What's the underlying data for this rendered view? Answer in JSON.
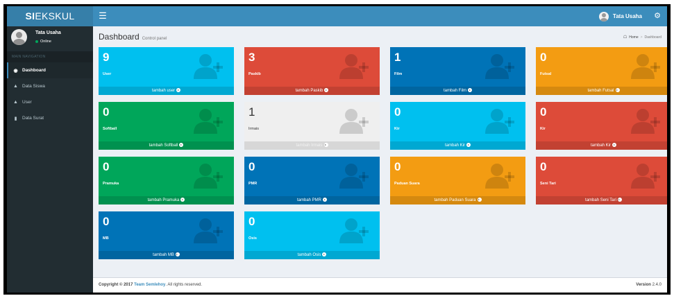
{
  "logo": {
    "bold": "SI",
    "rest": "EKSKUL"
  },
  "navbar": {
    "toggle_icon": "menu-icon",
    "user_name": "Tata Usaha",
    "settings_icon": "gears-icon"
  },
  "sidebar": {
    "user_name": "Tata Usaha",
    "status": "Online",
    "header": "MAIN NAVIGATION",
    "items": [
      {
        "label": "Dashboard",
        "icon": "dashboard-icon",
        "active": true
      },
      {
        "label": "Data Siswa",
        "icon": "user-icon",
        "active": false
      },
      {
        "label": "User",
        "icon": "user-icon",
        "active": false
      },
      {
        "label": "Data Surat",
        "icon": "file-icon",
        "active": false
      }
    ]
  },
  "content_header": {
    "title": "Dashboard",
    "subtitle": "Control panel"
  },
  "breadcrumb": {
    "home": "Home",
    "current": "Dashboard"
  },
  "boxes": [
    {
      "count": "9",
      "label": "User",
      "link": "tambah user",
      "color": "#00c0ef"
    },
    {
      "count": "3",
      "label": "Paskib",
      "link": "tambah Paskib",
      "color": "#dd4b39"
    },
    {
      "count": "1",
      "label": "Film",
      "link": "tambah Film",
      "color": "#0073b7"
    },
    {
      "count": "0",
      "label": "Futsal",
      "link": "tambah Futsal",
      "color": "#f39c12"
    },
    {
      "count": "0",
      "label": "Softball",
      "link": "tambah Softball",
      "color": "#00a65a"
    },
    {
      "count": "1",
      "label": "Irmais",
      "link": "tambah Irmais",
      "color": "#efefef"
    },
    {
      "count": "0",
      "label": "Kir",
      "link": "tambah Kir",
      "color": "#00c0ef"
    },
    {
      "count": "0",
      "label": "Kir",
      "link": "tambah Kir",
      "color": "#dd4b39"
    },
    {
      "count": "0",
      "label": "Pramuka",
      "link": "tambah Pramuka",
      "color": "#00a65a"
    },
    {
      "count": "0",
      "label": "PMR",
      "link": "tambah PMR",
      "color": "#0073b7"
    },
    {
      "count": "0",
      "label": "Paduan Suara",
      "link": "tambah Paduan Suara",
      "color": "#f39c12"
    },
    {
      "count": "0",
      "label": "Seni Tari",
      "link": "tambah Seni Tari",
      "color": "#dd4b39"
    },
    {
      "count": "0",
      "label": "MB",
      "link": "tambah MB",
      "color": "#0073b7"
    },
    {
      "count": "0",
      "label": "Osis",
      "link": "tambah Osis",
      "color": "#00c0ef"
    }
  ],
  "footer": {
    "copyright": "Copyright © 2017",
    "team": "Team Semlehoy",
    "rights": ". All rights reserved.",
    "version_label": "Version",
    "version": "2.4.0"
  }
}
